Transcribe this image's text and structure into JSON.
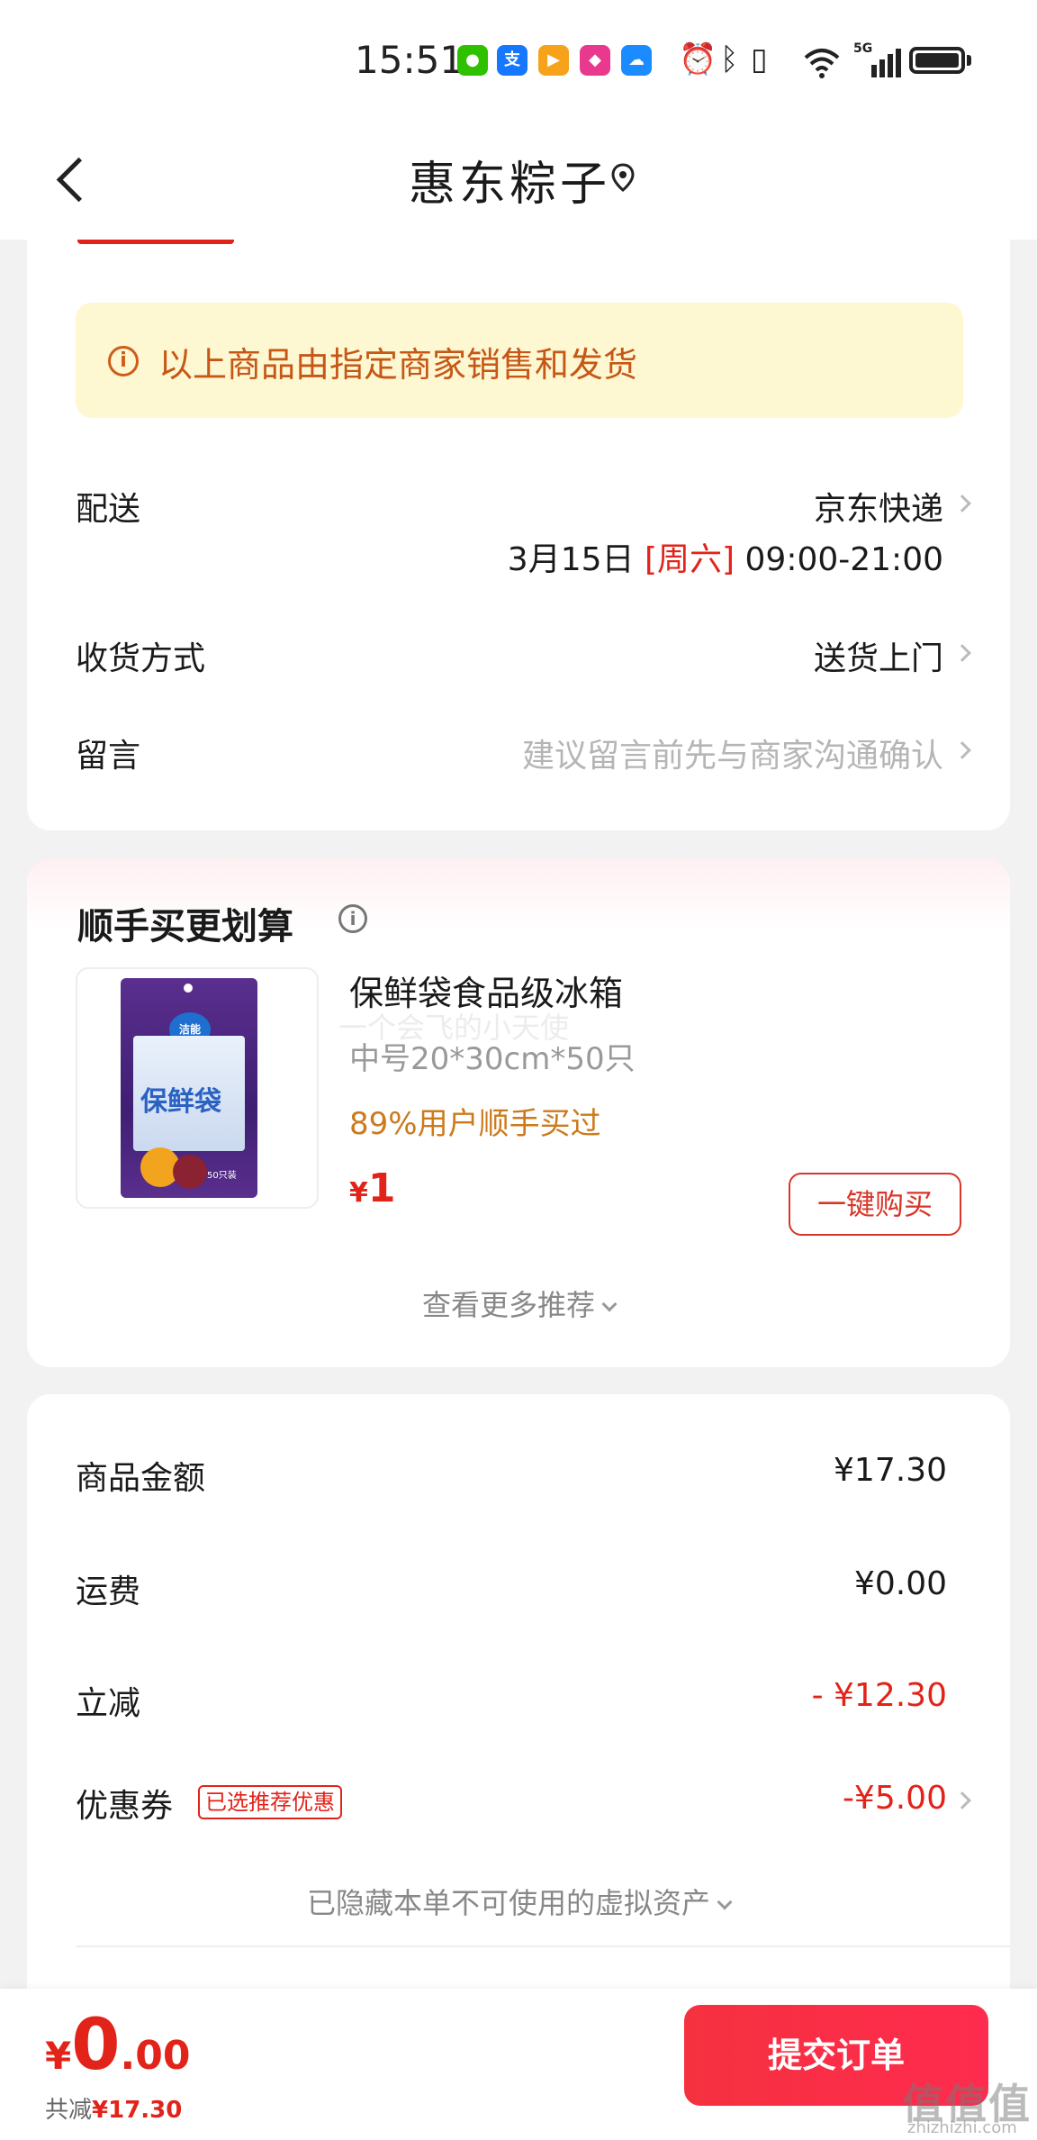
{
  "status_bar": {
    "time": "15:51",
    "network": "5G",
    "apps": [
      {
        "icon": "wechat-icon",
        "glyph": "●",
        "color": "#2dc100"
      },
      {
        "icon": "alipay-icon",
        "glyph": "支",
        "color": "#1677ff"
      },
      {
        "icon": "video-app-icon",
        "glyph": "▶",
        "color": "#f6a21b"
      },
      {
        "icon": "shopping-app-icon",
        "glyph": "◆",
        "color": "#e8398f"
      },
      {
        "icon": "cloud-app-icon",
        "glyph": "☁",
        "color": "#1a8cff"
      }
    ]
  },
  "header": {
    "title": "惠东粽子"
  },
  "notice": {
    "text": "以上商品由指定商家销售和发货"
  },
  "delivery": {
    "label": "配送",
    "carrier": "京东快递",
    "date": "3月15日",
    "weekday": "[周六]",
    "time_window": "09:00-21:00"
  },
  "receive_method": {
    "label": "收货方式",
    "value": "送货上门"
  },
  "message": {
    "label": "留言",
    "placeholder": "建议留言前先与商家沟通确认"
  },
  "recommend": {
    "title": "顺手买更划算",
    "product": {
      "name": "保鲜袋食品级冰箱",
      "spec": "中号20*30cm*50只",
      "social_proof": "89%用户顺手买过",
      "currency": "¥",
      "price": "1",
      "buy_label": "一键购买",
      "package_text": "保鲜袋",
      "package_brand": "洁能",
      "package_spec": "50只装"
    },
    "watermark": "一个会飞的小天使",
    "more_label": "查看更多推荐"
  },
  "totals": {
    "goods_label": "商品金额",
    "goods_value": "¥17.30",
    "shipping_label": "运费",
    "shipping_value": "¥0.00",
    "discount_label": "立减",
    "discount_value": "- ¥12.30",
    "coupon_label": "优惠券",
    "coupon_tag": "已选推荐优惠",
    "coupon_value": "-¥5.00",
    "hidden_assets": "已隐藏本单不可使用的虚拟资产"
  },
  "bottom": {
    "currency": "¥",
    "amount_int": "0",
    "amount_dec": ".00",
    "saved_label": "共减",
    "saved_value": "¥17.30",
    "submit_label": "提交订单"
  },
  "watermark_site": {
    "mark": "值值值",
    "url": "zhizhizhi.com"
  },
  "colors": {
    "accent": "#e2231a",
    "notice_bg": "#fdf7d2",
    "notice_text": "#c65716",
    "social_proof": "#cc7a1c",
    "submit_bg": "#f5313f"
  }
}
